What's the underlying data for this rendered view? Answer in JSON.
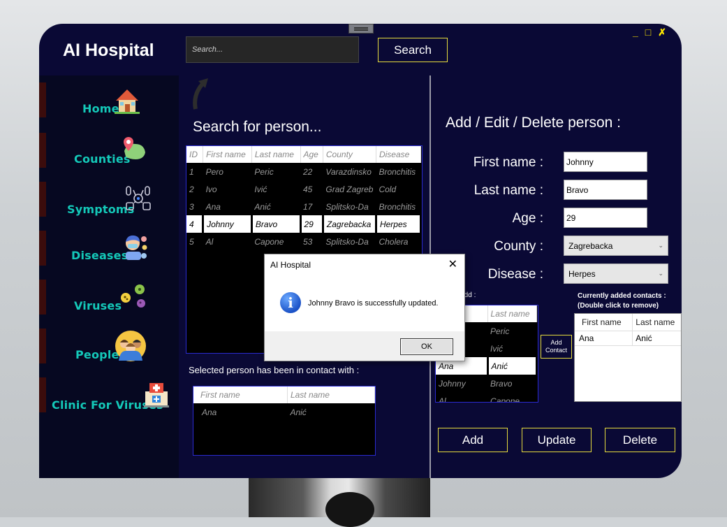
{
  "app": {
    "title": "AI Hospital"
  },
  "header": {
    "search_placeholder": "Search...",
    "search_button": "Search"
  },
  "sidebar": {
    "items": [
      {
        "label": "Home",
        "icon": "house-icon"
      },
      {
        "label": "Counties",
        "icon": "map-pin-icon"
      },
      {
        "label": "Symptoms",
        "icon": "symptoms-icon"
      },
      {
        "label": "Diseases",
        "icon": "sick-person-icon"
      },
      {
        "label": "Viruses",
        "icon": "virus-icon"
      },
      {
        "label": "People",
        "icon": "people-icon"
      },
      {
        "label": "Clinic For Viruses",
        "icon": "clinic-icon"
      }
    ]
  },
  "search_panel": {
    "title": "Search for person...",
    "columns": [
      "ID",
      "First name",
      "Last name",
      "Age",
      "County",
      "Disease"
    ],
    "rows": [
      [
        "1",
        "Pero",
        "Peric",
        "22",
        "Varazdinsko",
        "Bronchitis"
      ],
      [
        "2",
        "Ivo",
        "Ivić",
        "45",
        "Grad Zagreb",
        "Cold"
      ],
      [
        "3",
        "Ana",
        "Anić",
        "17",
        "Splitsko-Da",
        "Bronchitis"
      ],
      [
        "4",
        "Johnny",
        "Bravo",
        "29",
        "Zagrebacka",
        "Herpes"
      ],
      [
        "5",
        "Al",
        "Capone",
        "53",
        "Splitsko-Da",
        "Cholera"
      ]
    ],
    "selected_row": 3,
    "contacts_label": "Selected person has been in contact with :",
    "contacts_columns": [
      "First name",
      "Last name"
    ],
    "contacts_rows": [
      [
        "Ana",
        "Anić"
      ]
    ]
  },
  "edit_panel": {
    "title": "Add / Edit / Delete person :",
    "first_name_label": "First name :",
    "first_name_value": "Johnny",
    "last_name_label": "Last name :",
    "last_name_value": "Bravo",
    "age_label": "Age :",
    "age_value": "29",
    "county_label": "County :",
    "county_value": "Zagrebacka",
    "disease_label": "Disease :",
    "disease_value": "Herpes",
    "contacts_to_add_label": "to add :",
    "add_contact_columns": [
      "ame",
      "Last name"
    ],
    "add_contact_rows": [
      [
        "",
        "Peric"
      ],
      [
        "",
        "Ivić"
      ],
      [
        "Ana",
        "Anić"
      ],
      [
        "Johnny",
        "Bravo"
      ],
      [
        "Al",
        "Capone"
      ]
    ],
    "add_contact_selected": 2,
    "add_contact_button": "Add Contact",
    "currently_added_label": "Currently added contacts :",
    "currently_added_hint": "(Double click to remove)",
    "current_columns": [
      "First name",
      "Last name"
    ],
    "current_rows": [
      [
        "Ana",
        "Anić"
      ]
    ],
    "add_button": "Add",
    "update_button": "Update",
    "delete_button": "Delete"
  },
  "dialog": {
    "title": "AI Hospital",
    "message": "Johnny Bravo is successfully updated.",
    "ok_button": "OK",
    "close_glyph": "✕"
  },
  "window_controls": {
    "minimize": "_",
    "maximize": "□",
    "close": "✗"
  },
  "colors": {
    "app_bg": "#0a0935",
    "accent_yellow": "#e6dc3e",
    "nav_teal": "#14c9b9"
  }
}
